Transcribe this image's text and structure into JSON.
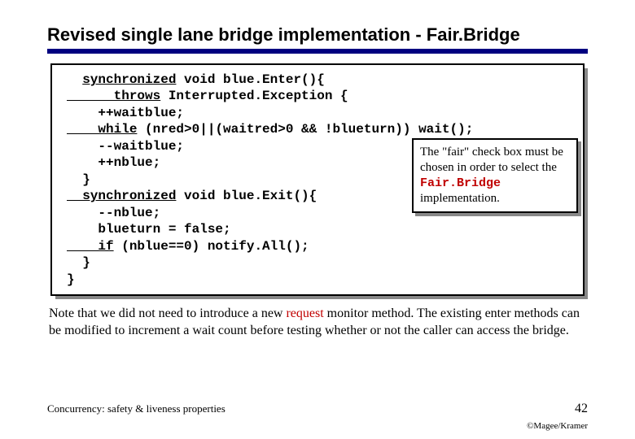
{
  "title": "Revised single lane bridge implementation - Fair.Bridge",
  "code": {
    "l1a": "synchronized",
    "l1b": " void blue.Enter(){",
    "l2a": "      throws",
    "l2b": " Interrupted.Exception {",
    "l3": "    ++waitblue;",
    "l4a": "    while",
    "l4b": " (nred>0||(waitred>0 && !blueturn)) wait();",
    "l5": "    --waitblue;",
    "l6": "    ++nblue;",
    "l7": "  }",
    "l8a": "  synchronized",
    "l8b": " void blue.Exit(){",
    "l9": "    --nblue;",
    "l10": "    blueturn = false;",
    "l11a": "    if",
    "l11b": " (nblue==0) notify.All();",
    "l12": "  }",
    "l13": "}"
  },
  "note": {
    "t1": "The \"fair\" check box must be chosen in order to select the ",
    "fair": "Fair.Bridge",
    "t2": " implementation."
  },
  "body": {
    "t1": "Note that we did not need to introduce a new ",
    "req": "request",
    "t2": " monitor method. The existing enter methods can be modified to increment a wait count before testing whether or not the caller can access the bridge."
  },
  "footer": {
    "left": "Concurrency: safety & liveness properties",
    "num": "42",
    "copy": "©Magee/Kramer"
  }
}
